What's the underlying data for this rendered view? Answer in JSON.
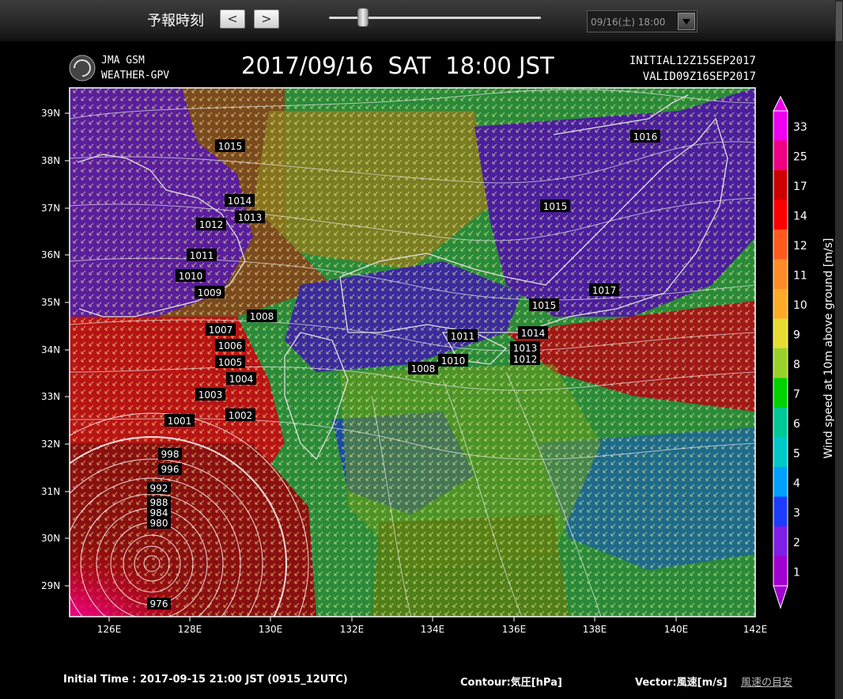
{
  "toolbar": {
    "forecast_time_label": "予報時刻",
    "prev_label": "<",
    "next_label": ">",
    "time_select_value": "09/16(土) 18:00"
  },
  "header": {
    "logo_line1": "JMA GSM",
    "logo_line2": "WEATHER-GPV",
    "title": "2017/09/16  SAT  18:00 JST",
    "initial": "INITIAL12Z15SEP2017",
    "valid": "VALID09Z16SEP2017"
  },
  "axes": {
    "lat_labels": [
      "39N",
      "38N",
      "37N",
      "36N",
      "35N",
      "34N",
      "33N",
      "32N",
      "31N",
      "30N",
      "29N"
    ],
    "lon_labels": [
      "126E",
      "128E",
      "130E",
      "132E",
      "134E",
      "136E",
      "138E",
      "140E",
      "142E"
    ]
  },
  "legend": {
    "title": "Wind speed at 10m above ground [m/s]",
    "levels": [
      "33",
      "25",
      "17",
      "14",
      "12",
      "11",
      "10",
      "9",
      "8",
      "7",
      "6",
      "5",
      "4",
      "3",
      "2",
      "1"
    ],
    "colors": [
      "#ee00ee",
      "#ee0080",
      "#cc0000",
      "#ff0000",
      "#ff5a1e",
      "#ff8c28",
      "#ffaa28",
      "#e6dc32",
      "#9ad22a",
      "#00d200",
      "#00c896",
      "#00c8c8",
      "#00a0ff",
      "#1e3cff",
      "#7e1ee6",
      "#a000d2"
    ]
  },
  "isobars": [
    "1016",
    "1015",
    "1015",
    "1014",
    "1013",
    "1012",
    "1011",
    "1010",
    "1009",
    "1008",
    "1007",
    "1006",
    "1005",
    "1004",
    "1003",
    "1002",
    "1001",
    "998",
    "996",
    "992",
    "988",
    "984",
    "980",
    "976",
    "1017",
    "1015",
    "1014",
    "1013",
    "1012",
    "1011",
    "1010",
    "1008"
  ],
  "footer": {
    "initial_time": "Initial Time : 2017-09-15 21:00 JST (0915_12UTC)",
    "contour": "Contour:気圧[hPa]",
    "vector": "Vector:風速[m/s]",
    "link": "風速の目安"
  }
}
